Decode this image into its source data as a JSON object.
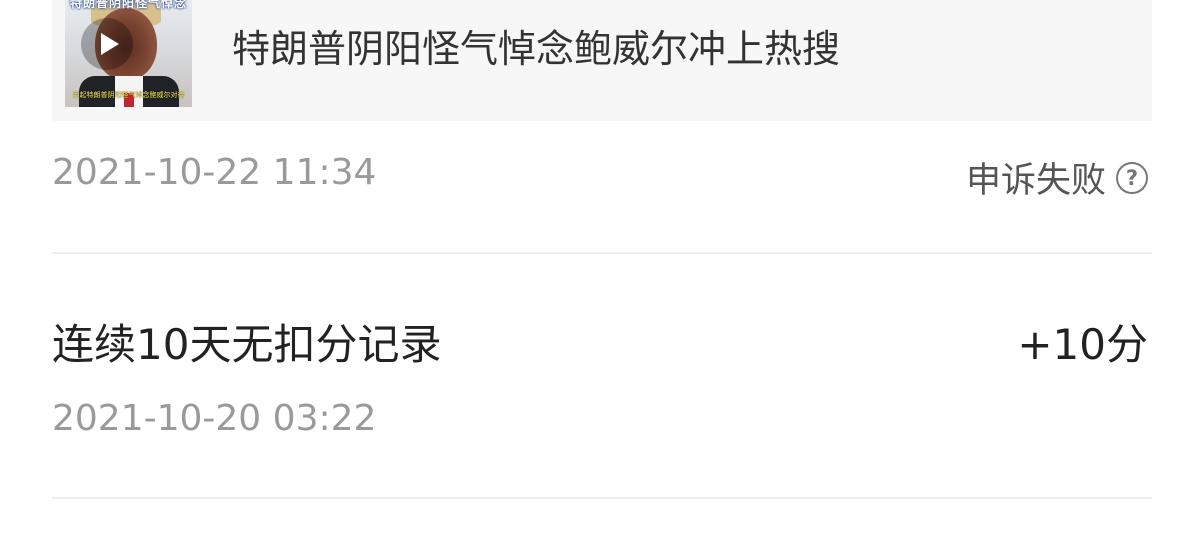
{
  "video_card": {
    "thumbnail_caption_top": "特朗普阴阳怪气悼念",
    "thumbnail_caption_bottom": "另起特朗普阴阳怪气悼念鲍威尔对待",
    "title": "特朗普阴阳怪气悼念鲍威尔冲上热搜"
  },
  "records": [
    {
      "date": "2021-10-22 11:34",
      "status": "申诉失败",
      "status_icon": "question-circle-icon"
    },
    {
      "title": "连续10天无扣分记录",
      "points": "+10分",
      "date": "2021-10-20 03:22"
    }
  ],
  "colors": {
    "background": "#ffffff",
    "card_background": "#f7f7f7",
    "secondary_text": "#9a9a9a",
    "primary_text": "#222222"
  }
}
